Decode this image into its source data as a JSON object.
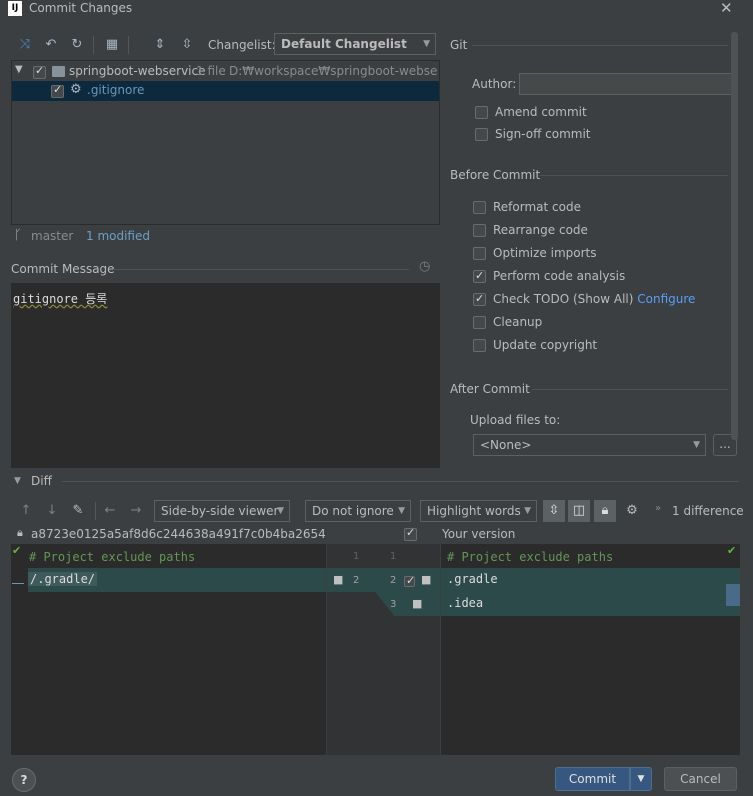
{
  "window": {
    "title": "Commit Changes",
    "app_icon": "IJ",
    "close_icon": "close-icon"
  },
  "toolbar": {
    "icons": [
      "refresh-icon",
      "rollback-icon",
      "update-icon",
      "group-icon",
      "expand-icon",
      "collapse-icon"
    ],
    "changelist_label": "Changelist:",
    "changelist_value": "Default Changelist"
  },
  "tree": {
    "root": {
      "name": "springboot-webservice",
      "count": "1 file",
      "path": "D:₩workspace₩springboot-webservice"
    },
    "child": {
      "name": ".gitignore"
    }
  },
  "status": {
    "branch": "master",
    "modified": "1 modified"
  },
  "commit_message": {
    "label": "Commit Message",
    "text": "gitignore 등록"
  },
  "git": {
    "label": "Git",
    "author_label": "Author:",
    "author_value": "",
    "amend": "Amend commit",
    "signoff": "Sign-off commit"
  },
  "before_commit": {
    "label": "Before Commit",
    "options": [
      {
        "label": "Reformat code",
        "checked": false
      },
      {
        "label": "Rearrange code",
        "checked": false
      },
      {
        "label": "Optimize imports",
        "checked": false
      },
      {
        "label": "Perform code analysis",
        "checked": true
      },
      {
        "label": "Check TODO (Show All)",
        "checked": true,
        "link": "Configure"
      },
      {
        "label": "Cleanup",
        "checked": false
      },
      {
        "label": "Update copyright",
        "checked": false
      }
    ]
  },
  "after_commit": {
    "label": "After Commit",
    "upload_label": "Upload files to:",
    "upload_value": "<None>",
    "browse": "..."
  },
  "diff": {
    "label": "Diff",
    "viewer": "Side-by-side viewer",
    "ignore": "Do not ignore",
    "highlight": "Highlight words",
    "differences": "1 difference",
    "left_title": "a8723e0125a5af8d6c244638a491f7c0b4ba2654",
    "right_title": "Your version",
    "left_lines": [
      "# Project exclude paths",
      "/.gradle/"
    ],
    "right_lines": [
      "# Project exclude paths",
      ".gradle",
      ".idea"
    ],
    "left_nums": [
      "1",
      "2"
    ],
    "right_nums": [
      "1",
      "2",
      "3"
    ]
  },
  "footer": {
    "help": "?",
    "commit": "Commit",
    "cancel": "Cancel"
  },
  "colors": {
    "bg": "#3c3f41",
    "editor": "#2b2b2b",
    "selection": "#0d293e",
    "link": "#589df6",
    "commit_btn": "#365880"
  }
}
